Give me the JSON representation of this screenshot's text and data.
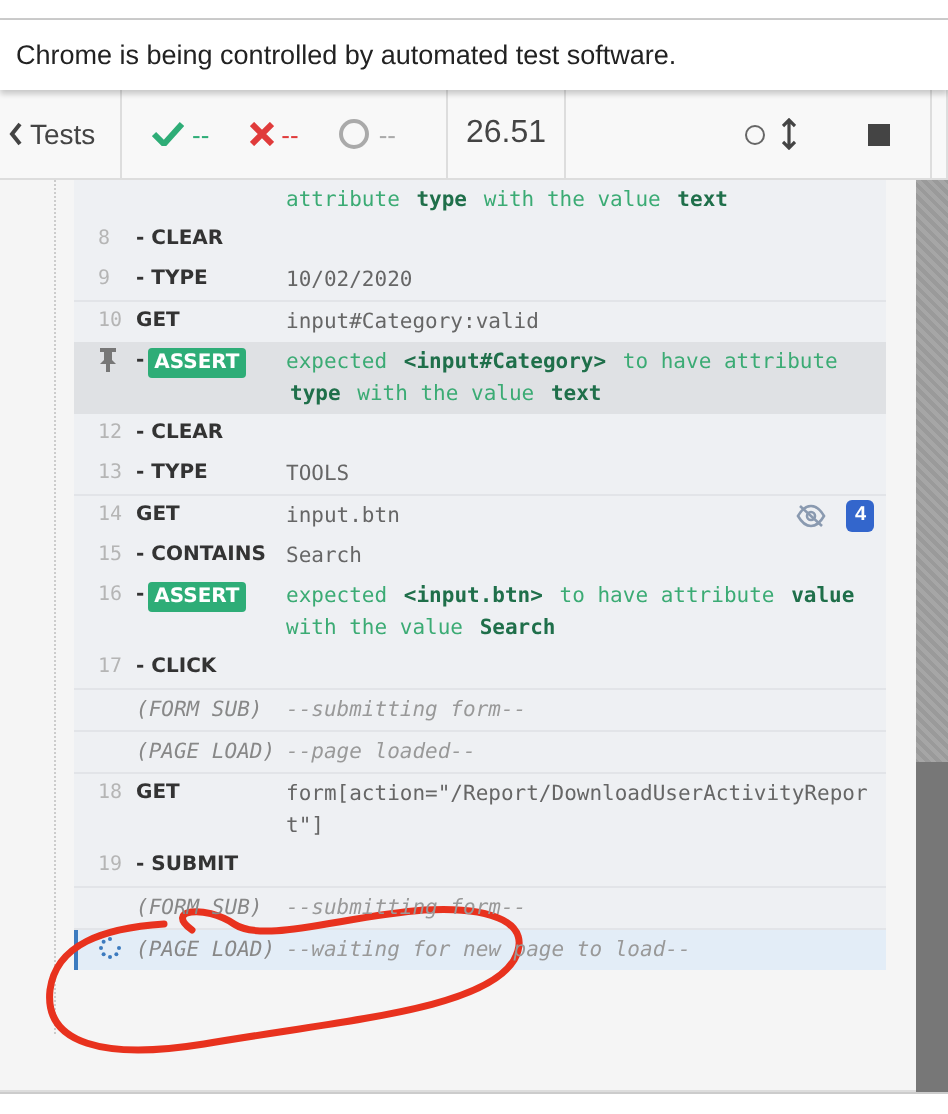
{
  "infobar": {
    "text": "Chrome is being controlled by automated test software."
  },
  "header": {
    "back_label": "Tests",
    "stats": [
      {
        "kind": "passed",
        "value": "--"
      },
      {
        "kind": "failed",
        "value": "--"
      },
      {
        "kind": "pending",
        "value": "--"
      }
    ],
    "duration": "26.51"
  },
  "groups": [
    {
      "rows": [
        {
          "kind": "assert",
          "message": "attribute **type** with the value **text**"
        },
        {
          "kind": "command",
          "number": "8",
          "name": "- CLEAR"
        },
        {
          "kind": "command",
          "number": "9",
          "name": "- TYPE",
          "message": "10/02/2020"
        }
      ]
    },
    {
      "rows": [
        {
          "kind": "command",
          "number": "10",
          "name": "GET",
          "message": "input#Category:valid"
        },
        {
          "kind": "assert",
          "pinned": true,
          "prefix": "-",
          "name": "ASSERT",
          "message": "expected **<input#Category>** to have attribute **type** with the value **text**"
        },
        {
          "kind": "command",
          "number": "12",
          "name": "- CLEAR"
        },
        {
          "kind": "command",
          "number": "13",
          "name": "- TYPE",
          "message": "TOOLS"
        }
      ]
    },
    {
      "rows": [
        {
          "kind": "command",
          "number": "14",
          "name": "GET",
          "message": "input.btn",
          "hidden": true,
          "badge": "4"
        },
        {
          "kind": "command",
          "number": "15",
          "name": "- CONTAINS",
          "message": "Search"
        },
        {
          "kind": "assert",
          "number": "16",
          "prefix": "-",
          "name": "ASSERT",
          "message": "expected **<input.btn>** to have attribute **value** with the value **Search**"
        },
        {
          "kind": "command",
          "number": "17",
          "name": "- CLICK"
        }
      ]
    },
    {
      "rows": [
        {
          "kind": "event",
          "name": "(FORM SUB)",
          "message": "--submitting form--"
        }
      ]
    },
    {
      "rows": [
        {
          "kind": "event",
          "name": "(PAGE LOAD)",
          "message": "--page loaded--"
        }
      ]
    },
    {
      "rows": [
        {
          "kind": "command",
          "number": "18",
          "name": "GET",
          "message": "form[action=\"/Report/DownloadUserActivityReport\"]"
        },
        {
          "kind": "command",
          "number": "19",
          "name": "- SUBMIT"
        }
      ]
    },
    {
      "rows": [
        {
          "kind": "event",
          "name": "(FORM SUB)",
          "message": "--submitting form--"
        }
      ]
    },
    {
      "rows": [
        {
          "kind": "event",
          "name": "(PAGE LOAD)",
          "message": "--waiting for new page to load--",
          "pending": true
        }
      ]
    }
  ]
}
